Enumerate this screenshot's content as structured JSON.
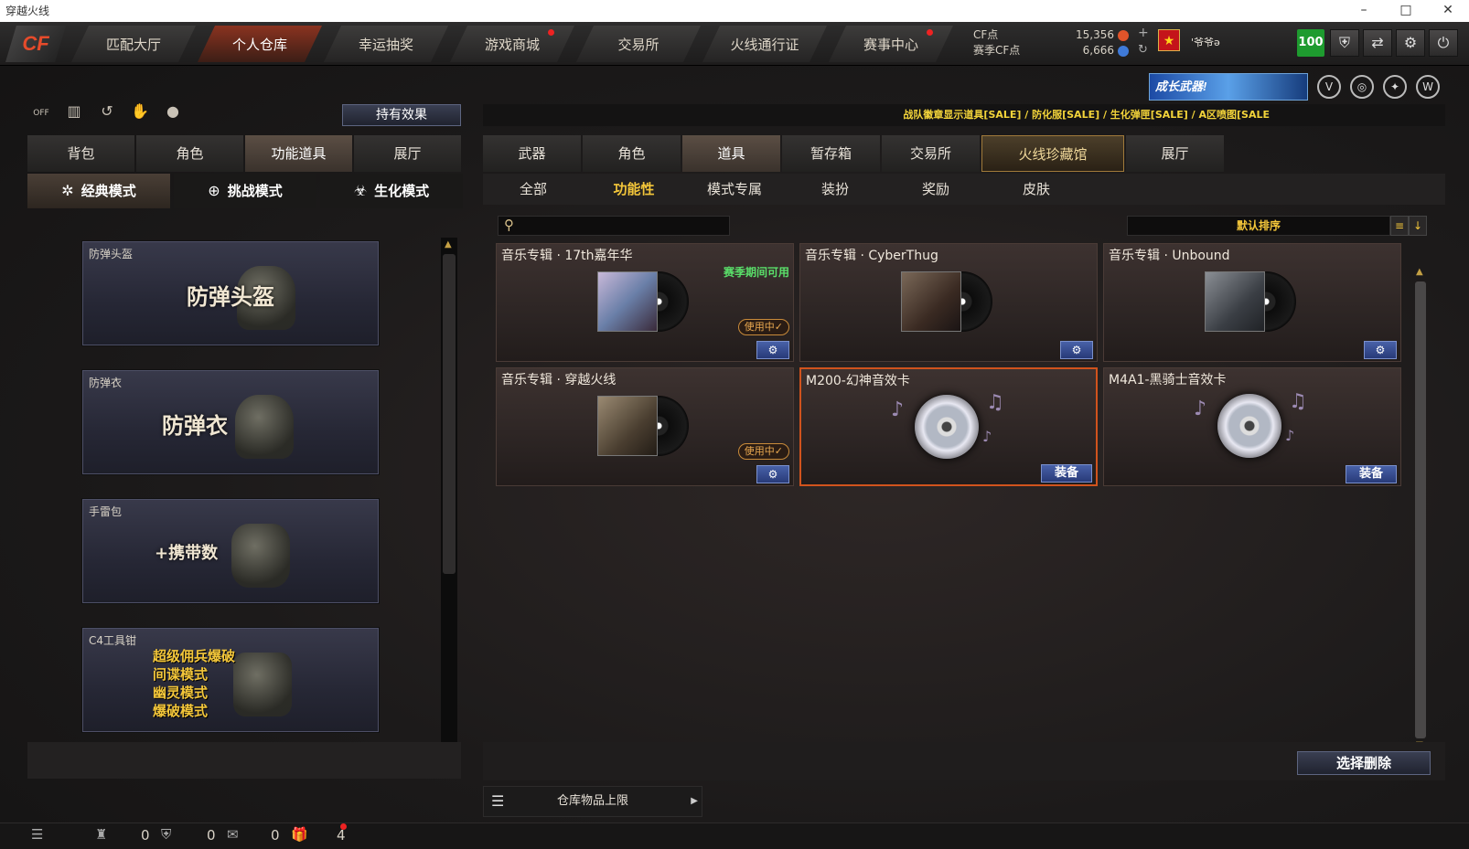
{
  "window": {
    "title": "穿越火线"
  },
  "nav": {
    "logo": "CF",
    "tabs": [
      {
        "label": "匹配大厅",
        "active": false,
        "dot": false
      },
      {
        "label": "个人仓库",
        "active": true,
        "dot": false
      },
      {
        "label": "幸运抽奖",
        "active": false,
        "dot": false
      },
      {
        "label": "游戏商城",
        "active": false,
        "dot": true
      },
      {
        "label": "交易所",
        "active": false,
        "dot": false
      },
      {
        "label": "火线通行证",
        "active": false,
        "dot": false
      },
      {
        "label": "赛事中心",
        "active": false,
        "dot": true
      }
    ]
  },
  "currency": {
    "cf_label": "CF点",
    "cf_value": "15,356",
    "season_label": "赛季CF点",
    "season_value": "6,666"
  },
  "user": {
    "name": "'爷爷ə",
    "level": "100"
  },
  "promo": {
    "label": "成长武器!"
  },
  "left": {
    "effect_button": "持有效果",
    "off_label": "OFF",
    "tabs": [
      "背包",
      "角色",
      "功能道具",
      "展厅"
    ],
    "active_tab": "功能道具",
    "modes": [
      "经典模式",
      "挑战模式",
      "生化模式"
    ],
    "items": [
      {
        "label": "防弹头盔",
        "title": "防弹头盔"
      },
      {
        "label": "防弹衣",
        "title": "防弹衣"
      },
      {
        "label": "手雷包",
        "title": "+携带数"
      },
      {
        "label": "C4工具钳",
        "lines": [
          "超级佣兵爆破",
          "间谍模式",
          "幽灵模式",
          "爆破模式"
        ]
      }
    ]
  },
  "right": {
    "ticker": "战队徽章显示道具[SALE] / 防化服[SALE] / 生化弹匣[SALE] / A区喷图[SALE",
    "tabs": [
      "武器",
      "角色",
      "道具",
      "暂存箱",
      "交易所",
      "火线珍藏馆",
      "展厅"
    ],
    "active_tab": "道具",
    "subtabs": [
      "全部",
      "功能性",
      "模式专属",
      "装扮",
      "奖励",
      "皮肤"
    ],
    "active_subtab": "功能性",
    "search_placeholder": "",
    "sort_label": "默认排序",
    "items": [
      {
        "title": "音乐专辑 · 17th嘉年华",
        "season": "赛季期间可用",
        "in_use": "使用中✓",
        "action": "gear"
      },
      {
        "title": "音乐专辑 · CyberThug",
        "season": "",
        "in_use": "",
        "action": "gear"
      },
      {
        "title": "音乐专辑 · Unbound",
        "season": "",
        "in_use": "",
        "action": "gear"
      },
      {
        "title": "音乐专辑 · 穿越火线",
        "season": "",
        "in_use": "使用中✓",
        "action": "gear"
      },
      {
        "title": "M200-幻神音效卡",
        "season": "",
        "in_use": "",
        "action": "装备",
        "selected": true
      },
      {
        "title": "M4A1-黑骑士音效卡",
        "season": "",
        "in_use": "",
        "action": "装备"
      }
    ],
    "delete_button": "选择删除",
    "capacity_label": "仓库物品上限"
  },
  "bottom": {
    "count1": "0",
    "count2": "0",
    "count3": "0",
    "count4": "4"
  },
  "colors": {
    "accent": "#f3c63a",
    "active_tab": "#8a3320",
    "button": "#283a78"
  }
}
